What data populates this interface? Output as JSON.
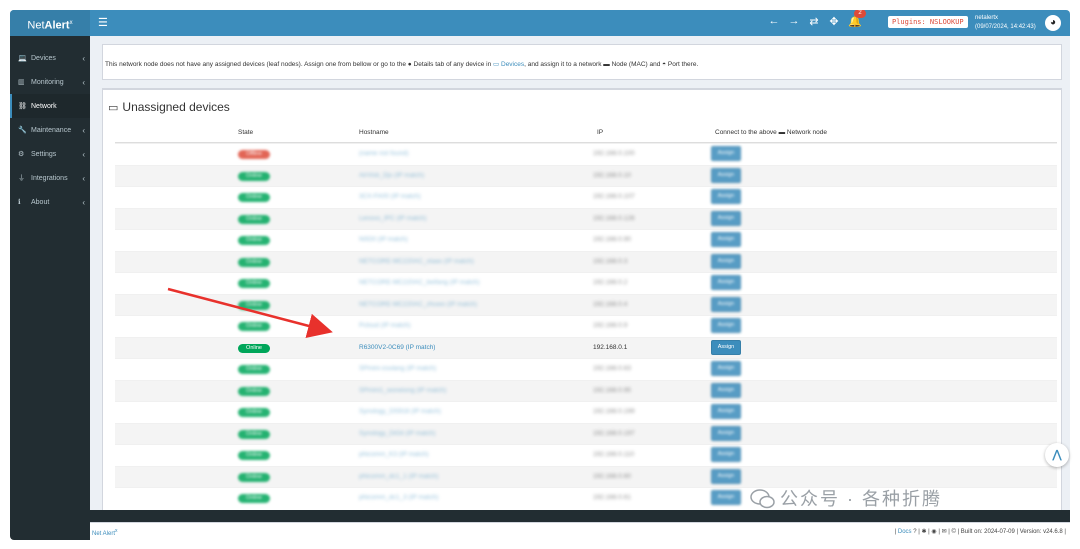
{
  "brand": {
    "name_light": "Net",
    "name_bold": "Alert",
    "sup": "x"
  },
  "header": {
    "plugins_badge": "Plugins: NSLOOKUP",
    "notification_count": "2",
    "user_name": "netalertx",
    "user_time": "(09/07/2024, 14:42:43)"
  },
  "sidebar": {
    "items": [
      {
        "label": "Devices",
        "icon": "laptop-icon"
      },
      {
        "label": "Monitoring",
        "icon": "chart-icon"
      },
      {
        "label": "Network",
        "icon": "sitemap-icon"
      },
      {
        "label": "Maintenance",
        "icon": "wrench-icon"
      },
      {
        "label": "Settings",
        "icon": "gear-icon"
      },
      {
        "label": "Integrations",
        "icon": "plug-icon"
      },
      {
        "label": "About",
        "icon": "info-icon"
      }
    ]
  },
  "info": {
    "part1": "This network node does not have any assigned devices (leaf nodes). Assign one from bellow or go to the ",
    "details": " Details",
    "part2": " tab of any device in ",
    "devices_link": "Devices",
    "part3": ", and assign it to a network ",
    "node": " Node (MAC) and ",
    "port": " Port there."
  },
  "unassigned": {
    "title": "Unassigned devices",
    "columns": {
      "state": "State",
      "hostname": "Hostname",
      "ip": "IP",
      "connect": "Connect to the above",
      "connect_suffix": " Network node"
    },
    "assign_label": "Assign",
    "rows": [
      {
        "state": "Offline",
        "hostname": "(name not found)",
        "ip": "192.168.0.100",
        "blurred": true
      },
      {
        "state": "Online",
        "hostname": "AirVisb_Djs (IP match)",
        "ip": "192.168.0.10",
        "blurred": true
      },
      {
        "state": "Online",
        "hostname": "3CX-FA00 (IP match)",
        "ip": "192.168.0.107",
        "blurred": true
      },
      {
        "state": "Online",
        "hostname": "Lenovo_IPC (IP match)",
        "ip": "192.168.0.126",
        "blurred": true
      },
      {
        "state": "Online",
        "hostname": "N0O0 (IP match)",
        "ip": "192.168.0.90",
        "blurred": true
      },
      {
        "state": "Online",
        "hostname": "NETCORE-MC220AC_xtaas (IP match)",
        "ip": "192.168.0.3",
        "blurred": true
      },
      {
        "state": "Online",
        "hostname": "NETCORE-MC220AC_beifang (IP match)",
        "ip": "192.168.0.2",
        "blurred": true
      },
      {
        "state": "Online",
        "hostname": "NETCORE-MC220AC_zhuwo (IP match)",
        "ip": "192.168.0.4",
        "blurred": true
      },
      {
        "state": "Online",
        "hostname": "Pcloud (IP match)",
        "ip": "192.168.0.9",
        "blurred": true
      },
      {
        "state": "Online",
        "hostname": "R6300V2-0C69 (IP match)",
        "ip": "192.168.0.1",
        "blurred": false
      },
      {
        "state": "Online",
        "hostname": "SPmini-zoulang (IP match)",
        "ip": "192.168.0.63",
        "blurred": true
      },
      {
        "state": "Online",
        "hostname": "SPmini1_woneiong (IP match)",
        "ip": "192.168.0.95",
        "blurred": true
      },
      {
        "state": "Online",
        "hostname": "Synology_DS918 (IP match)",
        "ip": "192.168.0.199",
        "blurred": true
      },
      {
        "state": "Online",
        "hostname": "Synology_DiGit (IP match)",
        "ip": "192.168.0.197",
        "blurred": true
      },
      {
        "state": "Online",
        "hostname": "phicomm_K3 (IP match)",
        "ip": "192.168.0.110",
        "blurred": true
      },
      {
        "state": "Online",
        "hostname": "phicomm_dc1_1 (IP match)",
        "ip": "192.168.0.60",
        "blurred": true
      },
      {
        "state": "Online",
        "hostname": "phicomm_dc1_3 (IP match)",
        "ip": "192.168.0.61",
        "blurred": true
      }
    ]
  },
  "footer": {
    "brand": "Net Alert",
    "brand_sup": "x",
    "docs": "Docs",
    "built": "| © | Built on: 2024-07-09 | Version: v24.6.8 |"
  },
  "watermark": "公众号 · 各种折腾",
  "colors": {
    "topbar": "#3c8dbc",
    "sidebar": "#222d32",
    "online": "#00a65a",
    "offline": "#dd4b39",
    "arrow": "#e8312c"
  }
}
